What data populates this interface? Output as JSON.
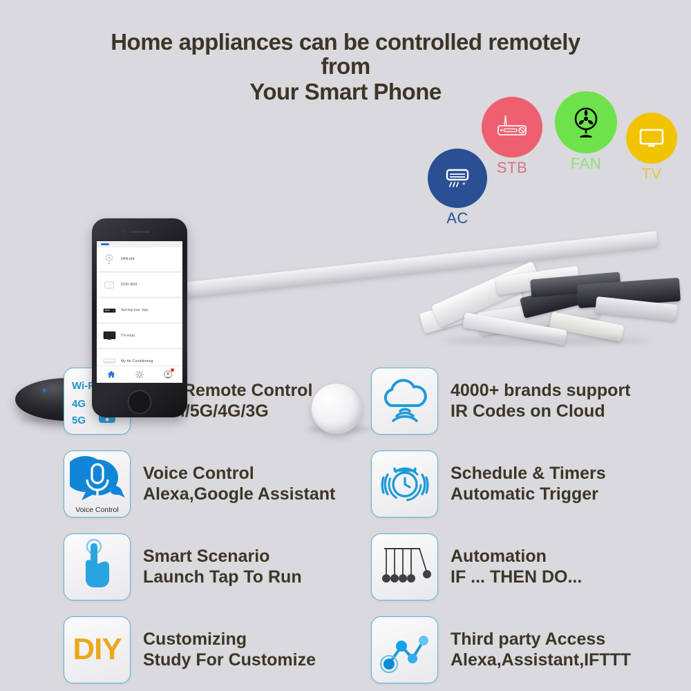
{
  "headline": {
    "line1": "Home appliances can be controlled remotely",
    "line2": "from",
    "line3": "Your Smart Phone",
    "color": "#3d3526"
  },
  "background_color": "#d9d9de",
  "phone": {
    "device_list": [
      {
        "name": "FAN-pitt",
        "icon": "fan-icon"
      },
      {
        "name": "DVD-952t",
        "icon": "dvd-player-icon"
      },
      {
        "name": "Set-top box -tnjv",
        "icon": "set-top-box-icon"
      },
      {
        "name": "TV-moai",
        "icon": "tv-icon"
      },
      {
        "name": "My Air Conditioning",
        "icon": "air-conditioner-icon"
      }
    ],
    "nav": [
      {
        "label": "home",
        "icon": "home-icon",
        "active": true,
        "badge": false
      },
      {
        "label": "settings",
        "icon": "gear-icon",
        "active": false,
        "badge": false
      },
      {
        "label": "profile",
        "icon": "profile-icon",
        "active": false,
        "badge": true
      }
    ]
  },
  "hardware": {
    "ir_blaster": "black-ir-blaster-puck",
    "remotes_pile": "pile-of-infrared-remote-controls",
    "seesaw": "balance-plank-with-ball-fulcrum"
  },
  "categories": [
    {
      "label": "AC",
      "icon": "air-conditioner-icon",
      "color": "#2a4f93",
      "text_color": "#2a4f93"
    },
    {
      "label": "STB",
      "icon": "set-top-box-icon",
      "color": "#ee6070",
      "text_color": "#d9737f"
    },
    {
      "label": "FAN",
      "icon": "fan-icon",
      "color": "#6ee24b",
      "text_color": "#8ce276"
    },
    {
      "label": "TV",
      "icon": "tv-icon",
      "color": "#f2c300",
      "text_color": "#e8c43c"
    }
  ],
  "features": {
    "left": [
      {
        "icon": "wifi-phone-icon",
        "icon_labels": [
          "Wi-Fi",
          "4G",
          "5G"
        ],
        "line1": "APP Remote Control",
        "line2": "Wi-Fi/5G/4G/3G"
      },
      {
        "icon": "voice-control-microphone-icon",
        "caption": "Voice Control",
        "line1": "Voice Control",
        "line2": "Alexa,Google Assistant"
      },
      {
        "icon": "tap-finger-icon",
        "line1": "Smart Scenario",
        "line2": "Launch Tap To Run"
      },
      {
        "icon": "diy-icon",
        "icon_text": "DIY",
        "line1": "Customizing",
        "line2": "Study For Customize"
      }
    ],
    "right": [
      {
        "icon": "cloud-signal-icon",
        "line1": "4000+ brands support",
        "line2": "IR Codes on Cloud"
      },
      {
        "icon": "alarm-clock-icon",
        "line1": "Schedule & Timers",
        "line2": "Automatic Trigger"
      },
      {
        "icon": "newtons-cradle-icon",
        "line1": "Automation",
        "line2": "IF ... THEN DO..."
      },
      {
        "icon": "network-nodes-icon",
        "line1": "Third party Access",
        "line2": "Alexa,Assistant,IFTTT"
      }
    ]
  },
  "colors": {
    "tile_border": "#5ab4d8",
    "icon_blue": "#1f9ad6",
    "diy_yellow": "#eaa81b",
    "text_dark": "#3d3526"
  }
}
